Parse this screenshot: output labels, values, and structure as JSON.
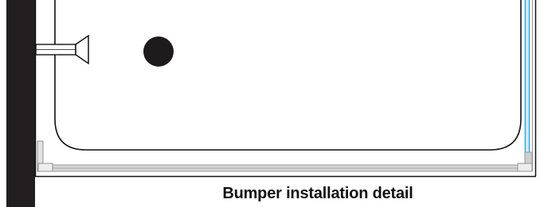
{
  "diagram": {
    "caption": "Bumper installation detail",
    "colors": {
      "wall": "#231f20",
      "outline": "#111111",
      "frame": "#9a9a9a",
      "frame_fill": "#d7d7d7",
      "glass": "#2aa4de",
      "knob": "#1e1b1c"
    }
  }
}
